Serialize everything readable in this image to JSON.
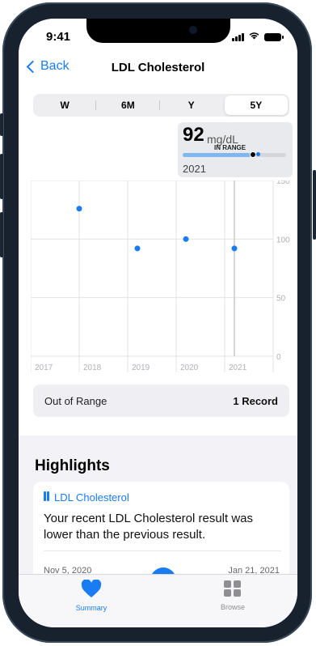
{
  "status_bar": {
    "time": "9:41"
  },
  "nav": {
    "back_label": "Back",
    "title": "LDL Cholesterol"
  },
  "segments": [
    {
      "label": "W",
      "active": false
    },
    {
      "label": "6M",
      "active": false
    },
    {
      "label": "Y",
      "active": false
    },
    {
      "label": "5Y",
      "active": true
    }
  ],
  "tooltip": {
    "value": "92",
    "unit": "mg/dL",
    "range_label": "IN RANGE",
    "year": "2021"
  },
  "chart_data": {
    "type": "scatter",
    "x_tick_labels": [
      "2017",
      "2018",
      "2019",
      "2020",
      "2021"
    ],
    "y_tick_labels": [
      "150",
      "100",
      "50",
      "0"
    ],
    "ylim": [
      0,
      150
    ],
    "points": [
      {
        "x": 2018.0,
        "y": 126
      },
      {
        "x": 2019.2,
        "y": 92
      },
      {
        "x": 2020.2,
        "y": 100
      },
      {
        "x": 2021.2,
        "y": 92
      }
    ],
    "selected_index": 3,
    "point_color": "#1a7cf2",
    "grid": true
  },
  "summary_row": {
    "label": "Out of Range",
    "value": "1 Record"
  },
  "highlights": {
    "heading": "Highlights",
    "card": {
      "title": "LDL Cholesterol",
      "body": "Your recent LDL Cholesterol result was lower than the previous result.",
      "date_left": "Nov 5, 2020",
      "date_right": "Jan 21, 2021"
    }
  },
  "tabbar": {
    "items": [
      {
        "label": "Summary",
        "icon": "heart-icon",
        "active": true
      },
      {
        "label": "Browse",
        "icon": "grid-icon",
        "active": false
      }
    ]
  },
  "colors": {
    "accent": "#1a7cf2",
    "inactive": "#8e8e93"
  }
}
